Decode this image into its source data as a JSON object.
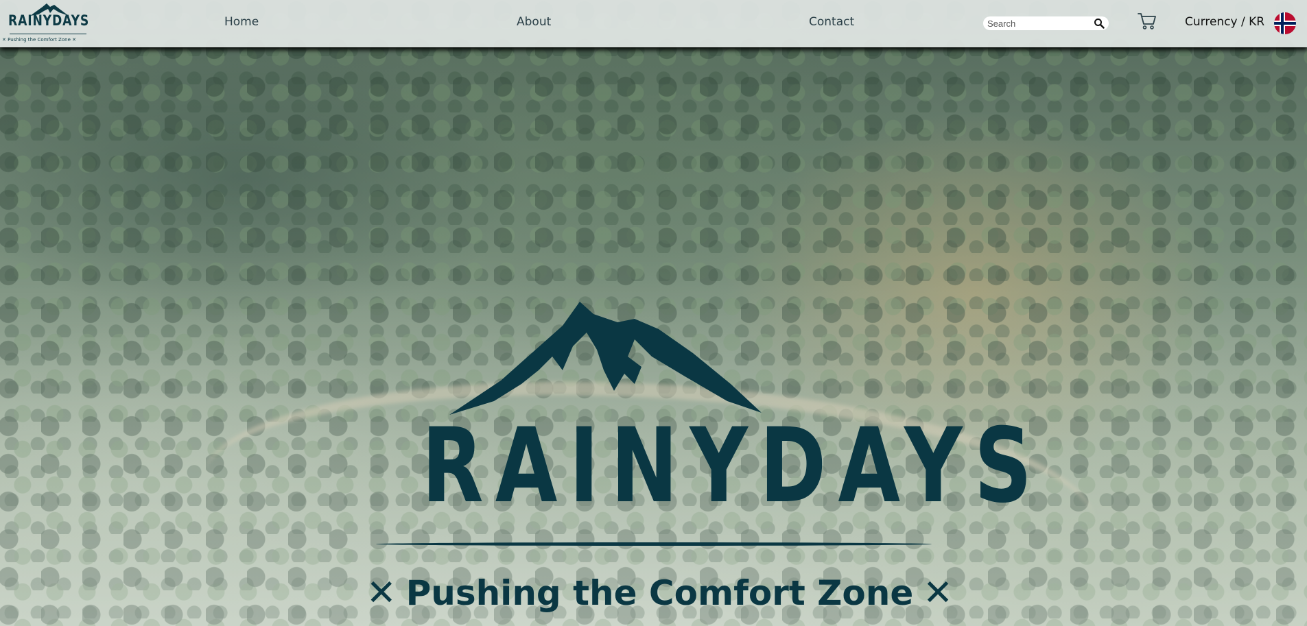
{
  "brand": {
    "name": "RAINYDAYS",
    "tagline": "Pushing the Comfort Zone",
    "tag_mark": "✕",
    "color": "#0a3743"
  },
  "nav": {
    "home": "Home",
    "about": "About",
    "contact": "Contact"
  },
  "search": {
    "placeholder": "Search",
    "value": ""
  },
  "currency": {
    "label": "Currency / KR"
  },
  "icons": {
    "search": "search-icon",
    "cart": "cart-icon",
    "flag": "norway-flag-icon"
  },
  "colors": {
    "header_bg": "#e2e7e5",
    "text_dark": "#2b4048",
    "flag_red": "#ba0c2f",
    "flag_blue": "#00205b"
  }
}
